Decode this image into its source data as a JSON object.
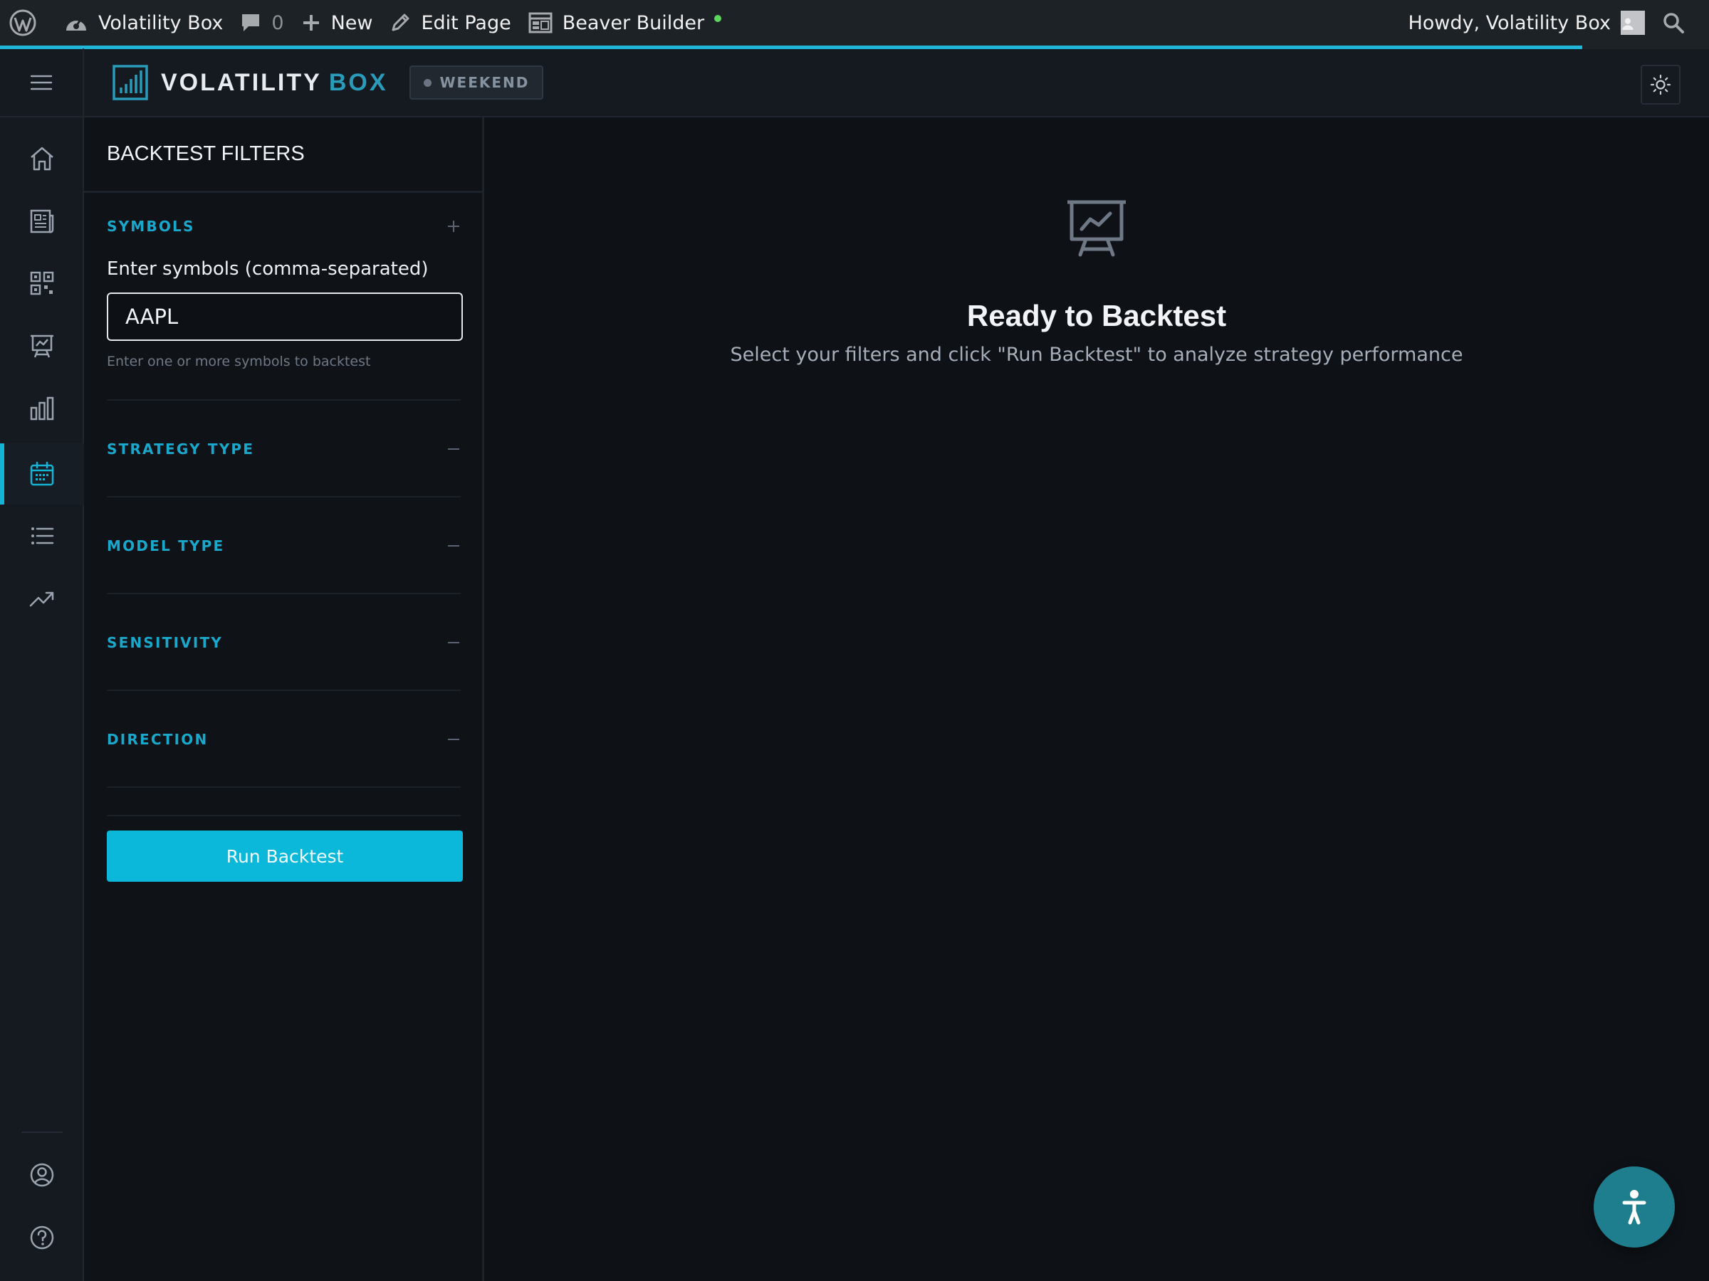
{
  "admin_bar": {
    "site_name": "Volatility Box",
    "comments_count": "0",
    "new_label": "New",
    "edit_label": "Edit Page",
    "builder_label": "Beaver Builder",
    "greeting": "Howdy, Volatility Box"
  },
  "loading_progress": 0.926,
  "brand": {
    "name": "VOLATILITY",
    "accent": "BOX",
    "accent_color": "#2a9bb8"
  },
  "market_status": "WEEKEND",
  "rail": {
    "items": [
      {
        "icon": "home-icon"
      },
      {
        "icon": "newspaper-icon"
      },
      {
        "icon": "scanner-grid-icon"
      },
      {
        "icon": "presentation-chart-icon"
      },
      {
        "icon": "bar-chart-icon"
      },
      {
        "icon": "calendar-icon",
        "active": true
      },
      {
        "icon": "list-icon"
      },
      {
        "icon": "trending-up-icon"
      }
    ],
    "bottom": [
      {
        "icon": "account-icon"
      },
      {
        "icon": "help-circle-icon"
      }
    ]
  },
  "filters": {
    "title": "BACKTEST FILTERS",
    "symbols": {
      "title": "SYMBOLS",
      "label": "Enter symbols (comma-separated)",
      "value": "AAPL",
      "hint": "Enter one or more symbols to backtest"
    },
    "sections": [
      {
        "title": "STRATEGY TYPE"
      },
      {
        "title": "MODEL TYPE"
      },
      {
        "title": "SENSITIVITY"
      },
      {
        "title": "DIRECTION"
      }
    ],
    "run_label": "Run Backtest"
  },
  "empty_state": {
    "title": "Ready to Backtest",
    "description": "Select your filters and click \"Run Backtest\" to analyze strategy performance"
  },
  "colors": {
    "accent": "#13b4d6",
    "button": "#0bb8d9",
    "background": "#0e1116"
  }
}
